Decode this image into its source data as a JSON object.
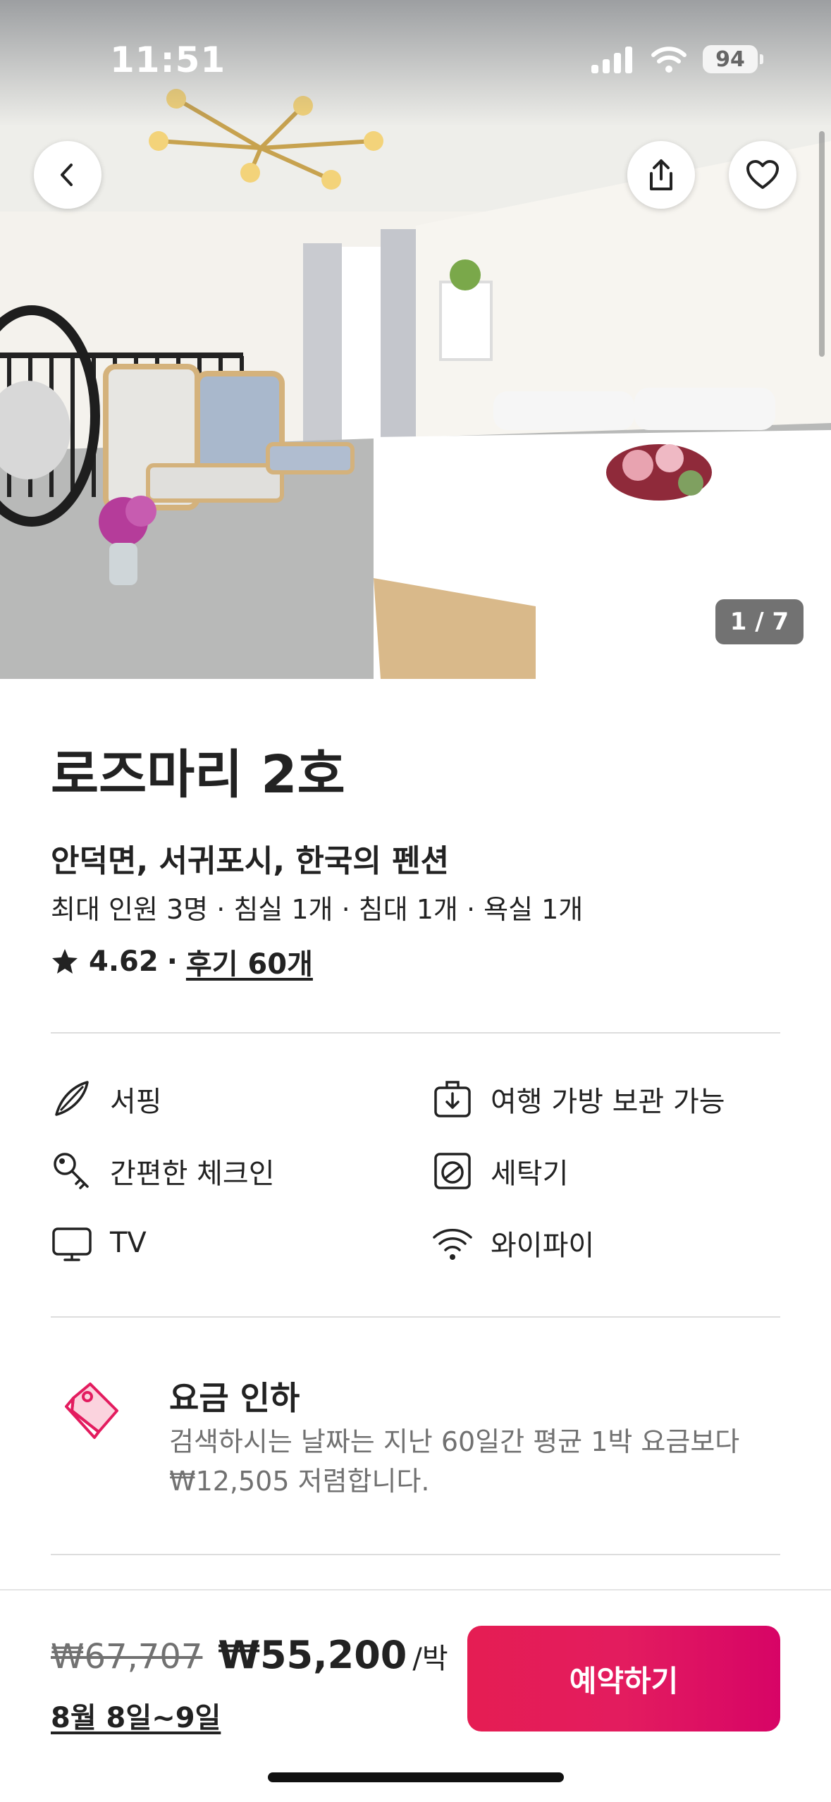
{
  "status_bar": {
    "time": "11:51",
    "battery": "94"
  },
  "photo": {
    "counter": "1 / 7"
  },
  "listing": {
    "title": "로즈마리 2호",
    "subtitle": "안덕면, 서귀포시, 한국의 펜션",
    "details": "최대 인원 3명 · 침실 1개 · 침대 1개 · 욕실 1개",
    "rating": "4.62",
    "separator": "·",
    "reviews": "후기 60개"
  },
  "amenities": [
    {
      "label": "서핑",
      "icon": "surfboard-icon"
    },
    {
      "label": "여행 가방 보관 가능",
      "icon": "luggage-icon"
    },
    {
      "label": "간편한 체크인",
      "icon": "key-icon"
    },
    {
      "label": "세탁기",
      "icon": "washer-icon"
    },
    {
      "label": "TV",
      "icon": "tv-icon"
    },
    {
      "label": "와이파이",
      "icon": "wifi-icon"
    }
  ],
  "promo": {
    "title": "요금 인하",
    "description": "검색하시는 날짜는 지난 60일간 평균 1박 요금보다 ₩12,505 저렴합니다.",
    "icon": "price-tag-icon"
  },
  "booking": {
    "old_price": "₩67,707",
    "price": "₩55,200",
    "per_night": "/박",
    "dates": "8월 8일~9일",
    "reserve_label": "예약하기"
  },
  "colors": {
    "brand": "#E31C5F",
    "text": "#222222",
    "muted": "#717171"
  }
}
